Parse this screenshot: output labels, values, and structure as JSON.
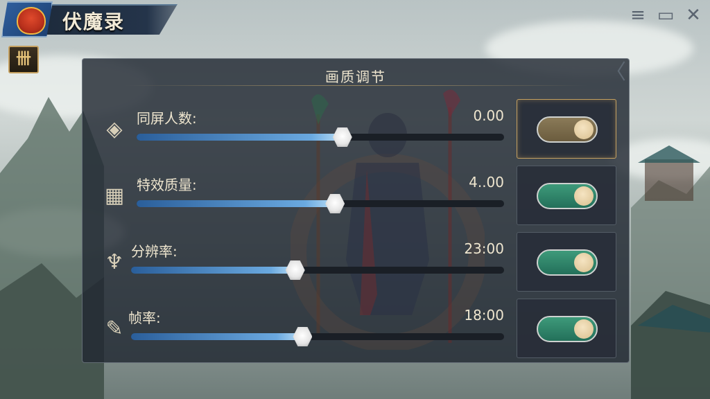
{
  "app": {
    "title": "伏魔录",
    "rune_button_label": "卌"
  },
  "window_controls": {
    "menu_icon": "≡",
    "screen_icon": "▭",
    "close_icon": "✕"
  },
  "panel": {
    "title": "画质调节",
    "close_label": "〈",
    "rows": [
      {
        "label": "同屏人数:",
        "value": "0.00",
        "level": 0.56,
        "toggle": "off",
        "icon": "◈"
      },
      {
        "label": "特效质量:",
        "value": "4..00",
        "level": 0.54,
        "toggle": "on",
        "icon": "▦"
      },
      {
        "label": "分辨率:",
        "value": "23:00",
        "level": 0.44,
        "toggle": "on",
        "icon": "♆"
      },
      {
        "label": "帧率:",
        "value": "18:00",
        "level": 0.46,
        "toggle": "on",
        "icon": "✎"
      }
    ]
  },
  "colors": {
    "accent_gold": "#c6a160",
    "toggle_on": "#2f8a6b",
    "toggle_off": "#8a7a58",
    "slider_fill": "#6aa9e0"
  }
}
